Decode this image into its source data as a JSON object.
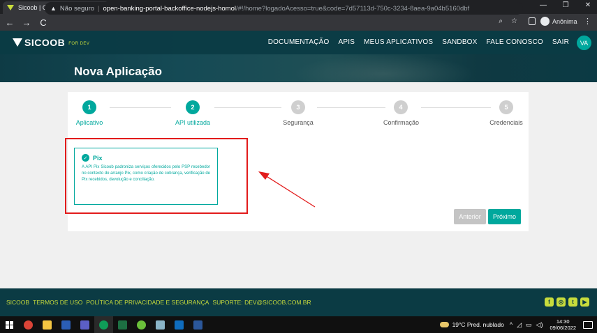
{
  "browser": {
    "tab_title": "Sicoob | Open Banking",
    "tab_close": "✕",
    "new_tab": "+",
    "window_buttons": [
      "—",
      "❐",
      "✕"
    ],
    "back": "←",
    "forward": "→",
    "reload": "C",
    "security_label": "Não seguro",
    "url_host": "open-banking-portal-backoffice-nodejs-homol",
    "url_path": "/#!/home?logadoAcesso=true&code=7d57113d-750c-3234-8aea-9a04b5160dbf",
    "profile_label": "Anônima"
  },
  "header": {
    "logo_text": "SICOOB",
    "logo_sub": "FOR DEV",
    "menu": [
      "DOCUMENTAÇÃO",
      "APIS",
      "MEUS APLICATIVOS",
      "SANDBOX",
      "FALE CONOSCO",
      "SAIR"
    ],
    "avatar": "VA",
    "page_title": "Nova Aplicação"
  },
  "stepper": {
    "steps": [
      {
        "num": "1",
        "label": "Aplicativo",
        "state": "active"
      },
      {
        "num": "2",
        "label": "API utilizada",
        "state": "active"
      },
      {
        "num": "3",
        "label": "Segurança",
        "state": "inactive"
      },
      {
        "num": "4",
        "label": "Confirmação",
        "state": "inactive"
      },
      {
        "num": "5",
        "label": "Credenciais",
        "state": "inactive"
      }
    ]
  },
  "api_card": {
    "name": "Pix",
    "description": "A API Pix Sicoob padroniza serviços oferecidos pelo PSP recebedor no contexto do arranjo Pix, como criação de cobrança, verificação de Pix recebidos, devolução e conciliação."
  },
  "buttons": {
    "previous": "Anterior",
    "next": "Próximo"
  },
  "footer": {
    "links": [
      "SICOOB",
      "TERMOS DE USO",
      "POLÍTICA DE PRIVACIDADE E SEGURANÇA",
      "SUPORTE: DEV@SICOOB.COM.BR"
    ],
    "social": [
      "f",
      "◎",
      "t",
      "▶"
    ]
  },
  "taskbar": {
    "weather": "19°C  Pred. nublado",
    "time": "14:30",
    "date": "09/06/2022"
  },
  "colors": {
    "brand_teal": "#00a89d",
    "header_bg": "#0b3b44",
    "footer_link": "#c8dc3c",
    "annotation_red": "#e21b1b"
  }
}
